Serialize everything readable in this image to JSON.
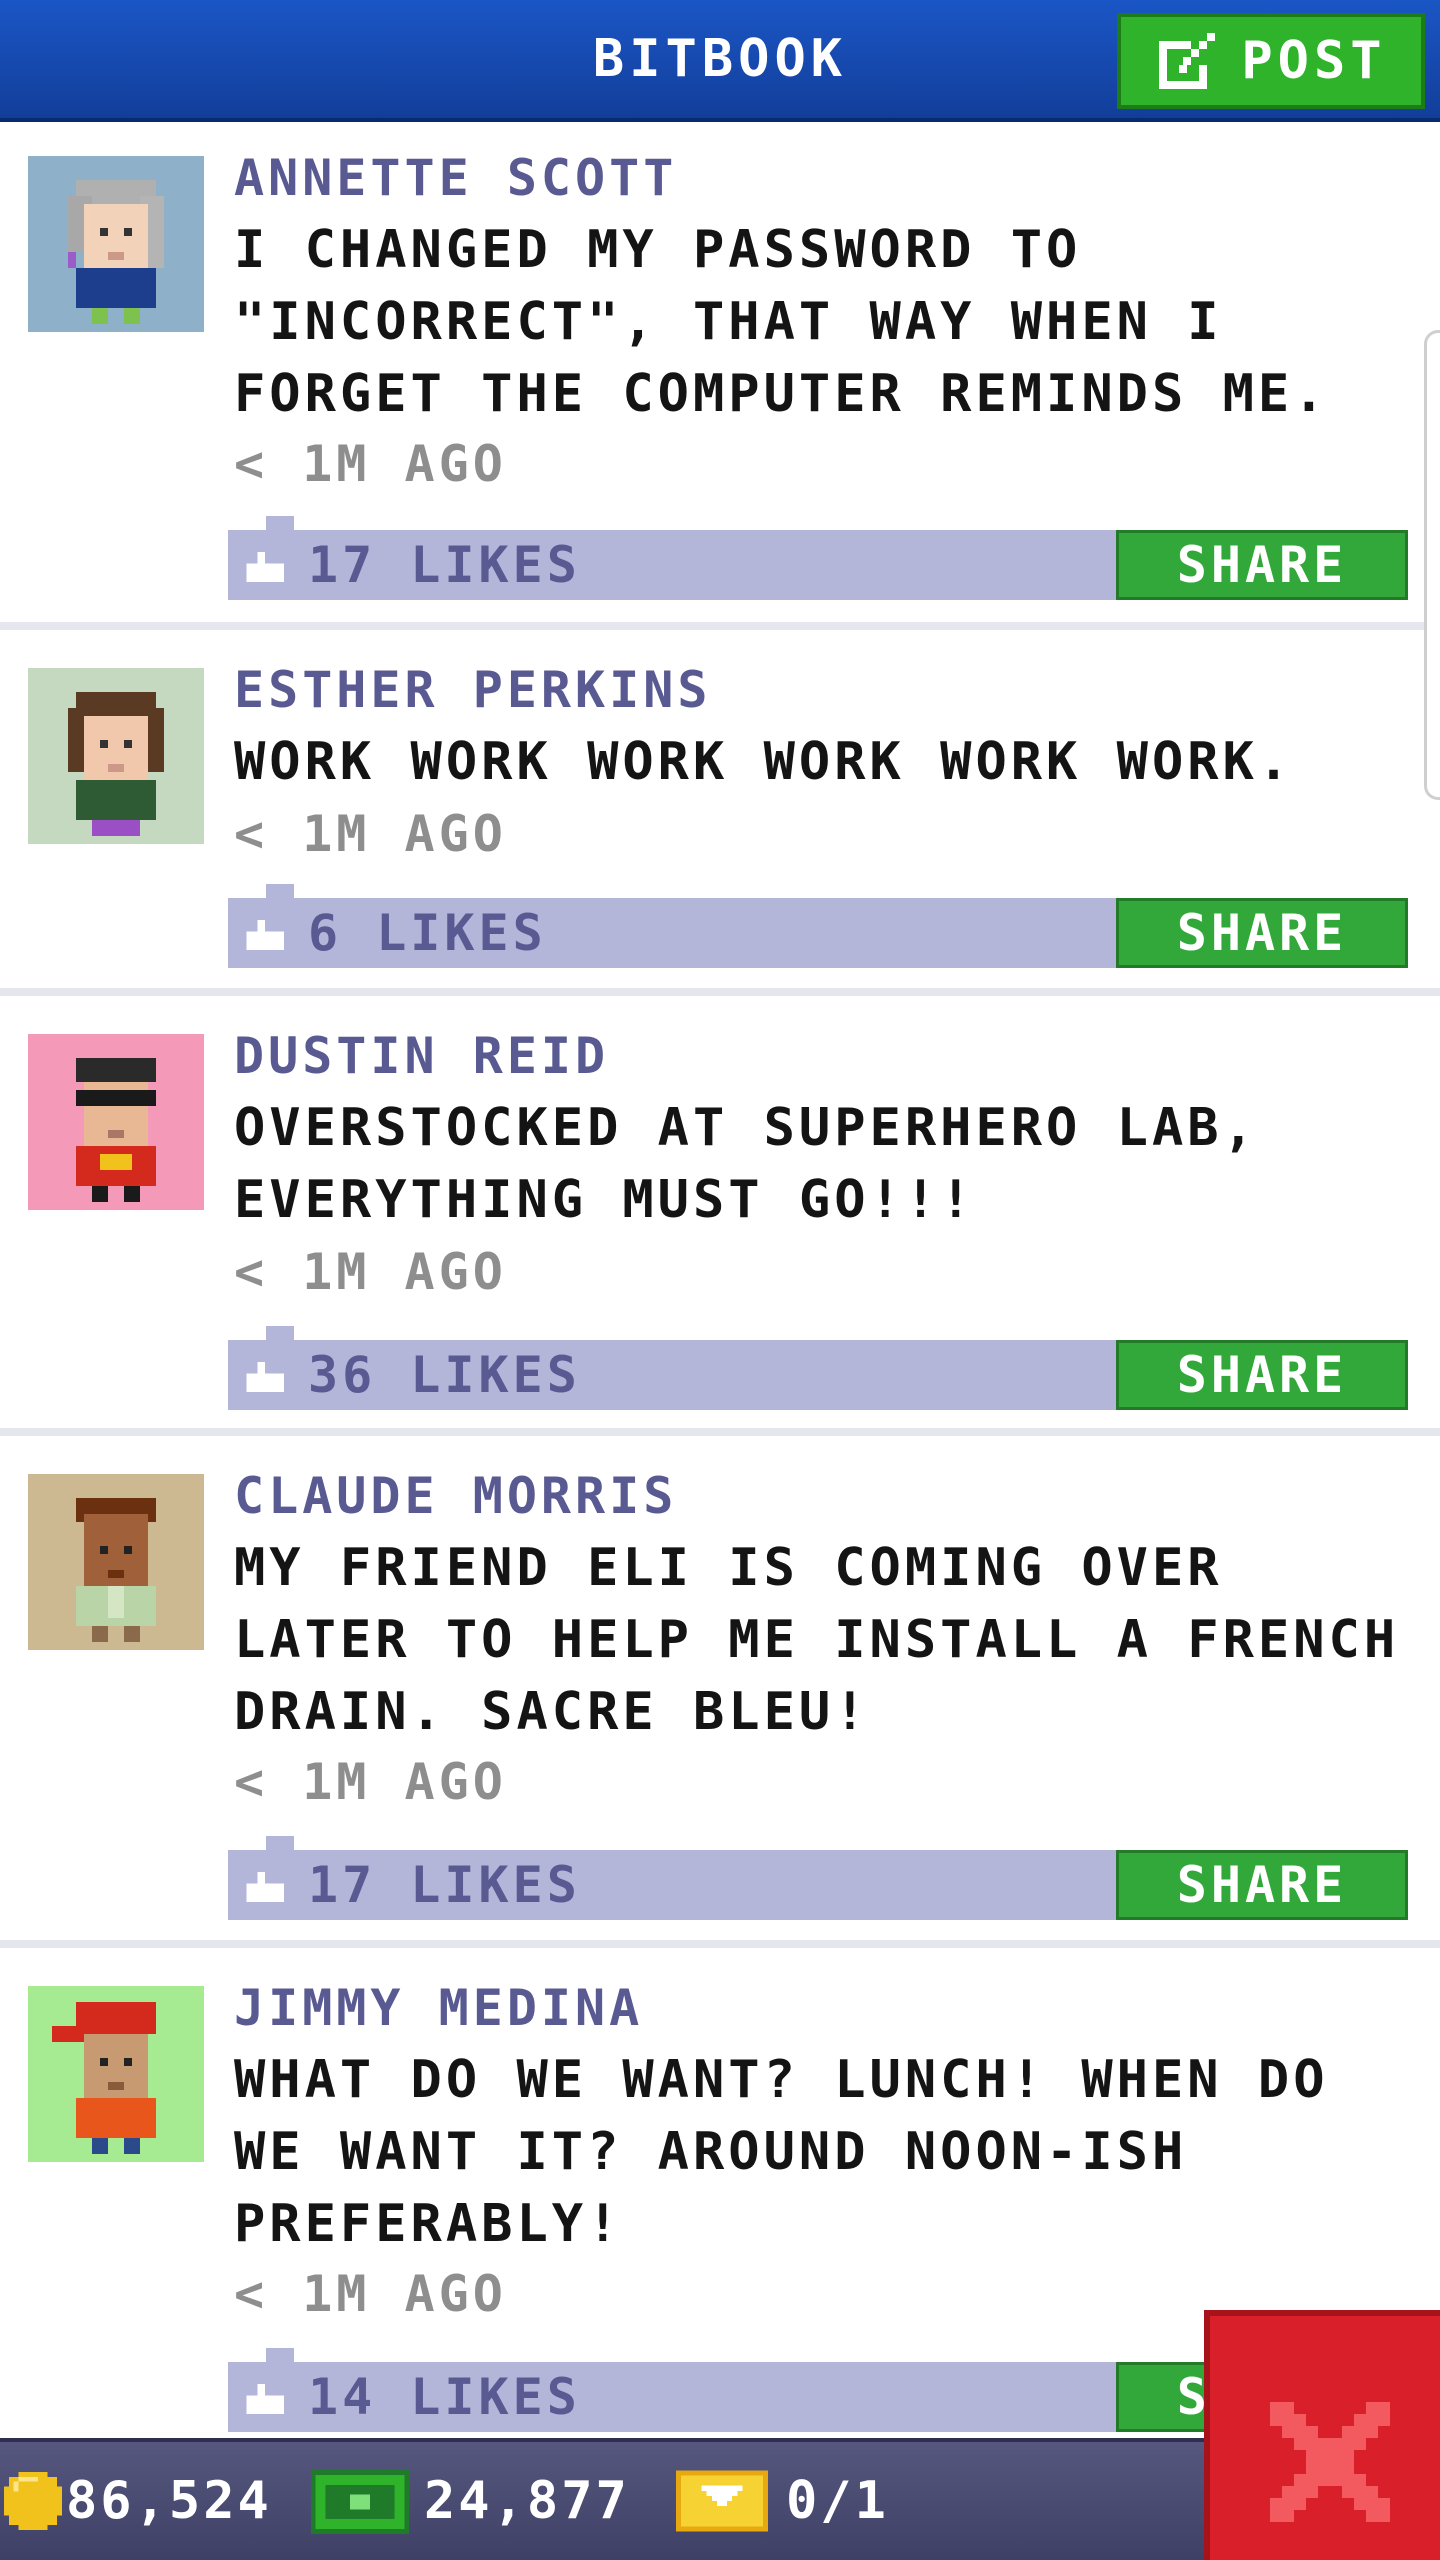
{
  "header": {
    "title": "BITBOOK",
    "post_label": "POST"
  },
  "posts": [
    {
      "author": "ANNETTE SCOTT",
      "message": "I CHANGED MY PASSWORD TO \"INCORRECT\", THAT WAY WHEN I FORGET THE COMPUTER REMINDS ME.",
      "time": "< 1M AGO",
      "likes": "17 LIKES",
      "share_label": "SHARE",
      "avatar_bg": "#8eb0c8"
    },
    {
      "author": "ESTHER PERKINS",
      "message": "WORK WORK WORK WORK WORK WORK.",
      "time": "< 1M AGO",
      "likes": "6 LIKES",
      "share_label": "SHARE",
      "avatar_bg": "#c4d9c0"
    },
    {
      "author": "DUSTIN REID",
      "message": "OVERSTOCKED AT SUPERHERO LAB, EVERYTHING MUST GO!!!",
      "time": "< 1M AGO",
      "likes": "36 LIKES",
      "share_label": "SHARE",
      "avatar_bg": "#f49ab8"
    },
    {
      "author": "CLAUDE MORRIS",
      "message": "MY FRIEND ELI IS COMING OVER LATER TO HELP ME INSTALL A FRENCH DRAIN. SACRE BLEU!",
      "time": "< 1M AGO",
      "likes": "17 LIKES",
      "share_label": "SHARE",
      "avatar_bg": "#cdb991"
    },
    {
      "author": "JIMMY MEDINA",
      "message": "WHAT DO WE WANT? LUNCH! WHEN DO WE WANT IT? AROUND NOON-ISH PREFERABLY!",
      "time": "< 1M AGO",
      "likes": "14 LIKES",
      "share_label": "SHARE",
      "avatar_bg": "#a6ea92"
    }
  ],
  "bottom_bar": {
    "coins": "86,524",
    "bux": "24,877",
    "tickets": "0/1"
  },
  "colors": {
    "header": "#1b56c6",
    "post_button": "#2fb32a",
    "likes_bar": "#b3b6d9",
    "share_button": "#33a83a",
    "close_button": "#d9202a"
  }
}
